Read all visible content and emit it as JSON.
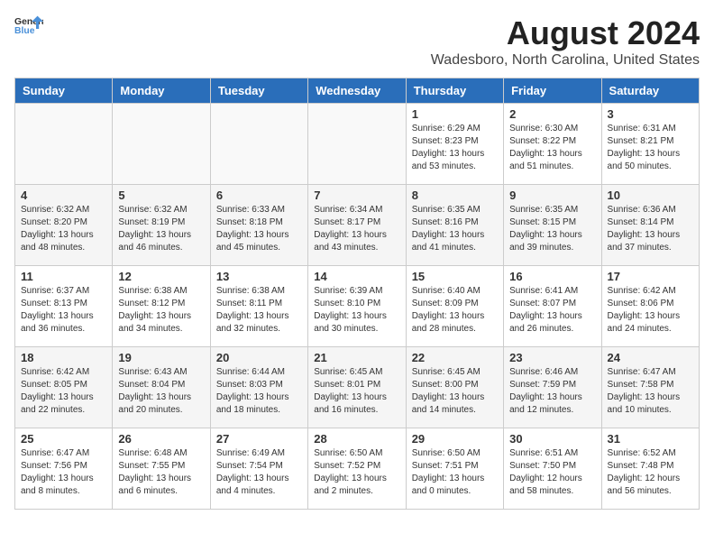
{
  "header": {
    "logo_general": "General",
    "logo_blue": "Blue",
    "month_title": "August 2024",
    "location": "Wadesboro, North Carolina, United States"
  },
  "days_of_week": [
    "Sunday",
    "Monday",
    "Tuesday",
    "Wednesday",
    "Thursday",
    "Friday",
    "Saturday"
  ],
  "weeks": [
    {
      "shade": "white",
      "days": [
        {
          "num": "",
          "info": ""
        },
        {
          "num": "",
          "info": ""
        },
        {
          "num": "",
          "info": ""
        },
        {
          "num": "",
          "info": ""
        },
        {
          "num": "1",
          "info": "Sunrise: 6:29 AM\nSunset: 8:23 PM\nDaylight: 13 hours\nand 53 minutes."
        },
        {
          "num": "2",
          "info": "Sunrise: 6:30 AM\nSunset: 8:22 PM\nDaylight: 13 hours\nand 51 minutes."
        },
        {
          "num": "3",
          "info": "Sunrise: 6:31 AM\nSunset: 8:21 PM\nDaylight: 13 hours\nand 50 minutes."
        }
      ]
    },
    {
      "shade": "shaded",
      "days": [
        {
          "num": "4",
          "info": "Sunrise: 6:32 AM\nSunset: 8:20 PM\nDaylight: 13 hours\nand 48 minutes."
        },
        {
          "num": "5",
          "info": "Sunrise: 6:32 AM\nSunset: 8:19 PM\nDaylight: 13 hours\nand 46 minutes."
        },
        {
          "num": "6",
          "info": "Sunrise: 6:33 AM\nSunset: 8:18 PM\nDaylight: 13 hours\nand 45 minutes."
        },
        {
          "num": "7",
          "info": "Sunrise: 6:34 AM\nSunset: 8:17 PM\nDaylight: 13 hours\nand 43 minutes."
        },
        {
          "num": "8",
          "info": "Sunrise: 6:35 AM\nSunset: 8:16 PM\nDaylight: 13 hours\nand 41 minutes."
        },
        {
          "num": "9",
          "info": "Sunrise: 6:35 AM\nSunset: 8:15 PM\nDaylight: 13 hours\nand 39 minutes."
        },
        {
          "num": "10",
          "info": "Sunrise: 6:36 AM\nSunset: 8:14 PM\nDaylight: 13 hours\nand 37 minutes."
        }
      ]
    },
    {
      "shade": "white",
      "days": [
        {
          "num": "11",
          "info": "Sunrise: 6:37 AM\nSunset: 8:13 PM\nDaylight: 13 hours\nand 36 minutes."
        },
        {
          "num": "12",
          "info": "Sunrise: 6:38 AM\nSunset: 8:12 PM\nDaylight: 13 hours\nand 34 minutes."
        },
        {
          "num": "13",
          "info": "Sunrise: 6:38 AM\nSunset: 8:11 PM\nDaylight: 13 hours\nand 32 minutes."
        },
        {
          "num": "14",
          "info": "Sunrise: 6:39 AM\nSunset: 8:10 PM\nDaylight: 13 hours\nand 30 minutes."
        },
        {
          "num": "15",
          "info": "Sunrise: 6:40 AM\nSunset: 8:09 PM\nDaylight: 13 hours\nand 28 minutes."
        },
        {
          "num": "16",
          "info": "Sunrise: 6:41 AM\nSunset: 8:07 PM\nDaylight: 13 hours\nand 26 minutes."
        },
        {
          "num": "17",
          "info": "Sunrise: 6:42 AM\nSunset: 8:06 PM\nDaylight: 13 hours\nand 24 minutes."
        }
      ]
    },
    {
      "shade": "shaded",
      "days": [
        {
          "num": "18",
          "info": "Sunrise: 6:42 AM\nSunset: 8:05 PM\nDaylight: 13 hours\nand 22 minutes."
        },
        {
          "num": "19",
          "info": "Sunrise: 6:43 AM\nSunset: 8:04 PM\nDaylight: 13 hours\nand 20 minutes."
        },
        {
          "num": "20",
          "info": "Sunrise: 6:44 AM\nSunset: 8:03 PM\nDaylight: 13 hours\nand 18 minutes."
        },
        {
          "num": "21",
          "info": "Sunrise: 6:45 AM\nSunset: 8:01 PM\nDaylight: 13 hours\nand 16 minutes."
        },
        {
          "num": "22",
          "info": "Sunrise: 6:45 AM\nSunset: 8:00 PM\nDaylight: 13 hours\nand 14 minutes."
        },
        {
          "num": "23",
          "info": "Sunrise: 6:46 AM\nSunset: 7:59 PM\nDaylight: 13 hours\nand 12 minutes."
        },
        {
          "num": "24",
          "info": "Sunrise: 6:47 AM\nSunset: 7:58 PM\nDaylight: 13 hours\nand 10 minutes."
        }
      ]
    },
    {
      "shade": "white",
      "days": [
        {
          "num": "25",
          "info": "Sunrise: 6:47 AM\nSunset: 7:56 PM\nDaylight: 13 hours\nand 8 minutes."
        },
        {
          "num": "26",
          "info": "Sunrise: 6:48 AM\nSunset: 7:55 PM\nDaylight: 13 hours\nand 6 minutes."
        },
        {
          "num": "27",
          "info": "Sunrise: 6:49 AM\nSunset: 7:54 PM\nDaylight: 13 hours\nand 4 minutes."
        },
        {
          "num": "28",
          "info": "Sunrise: 6:50 AM\nSunset: 7:52 PM\nDaylight: 13 hours\nand 2 minutes."
        },
        {
          "num": "29",
          "info": "Sunrise: 6:50 AM\nSunset: 7:51 PM\nDaylight: 13 hours\nand 0 minutes."
        },
        {
          "num": "30",
          "info": "Sunrise: 6:51 AM\nSunset: 7:50 PM\nDaylight: 12 hours\nand 58 minutes."
        },
        {
          "num": "31",
          "info": "Sunrise: 6:52 AM\nSunset: 7:48 PM\nDaylight: 12 hours\nand 56 minutes."
        }
      ]
    }
  ]
}
